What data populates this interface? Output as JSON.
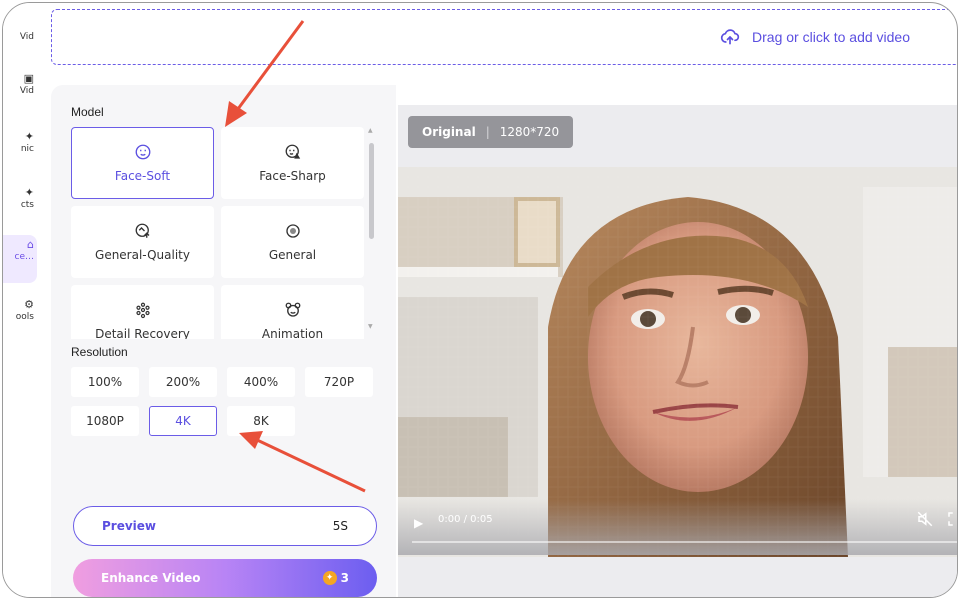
{
  "sidebar": {
    "items": [
      {
        "label": "Vid",
        "icon": "video-icon"
      },
      {
        "label": "Vid",
        "icon": "photo-video-icon"
      },
      {
        "label": "nic",
        "icon": "sparkle-icon"
      },
      {
        "label": "cts",
        "icon": "effects-icon"
      },
      {
        "label": "ce…",
        "icon": "enhance-icon",
        "active": true
      },
      {
        "label": "ools",
        "icon": "tools-icon"
      }
    ]
  },
  "upload": {
    "label": "Drag or click to add video"
  },
  "model_section": {
    "title": "Model",
    "models": [
      {
        "label": "Face-Soft",
        "icon": "face-soft-icon",
        "selected": true
      },
      {
        "label": "Face-Sharp",
        "icon": "face-sharp-icon"
      },
      {
        "label": "General-Quality",
        "icon": "general-quality-icon"
      },
      {
        "label": "General",
        "icon": "general-icon"
      },
      {
        "label": "Detail Recovery",
        "icon": "detail-recovery-icon"
      },
      {
        "label": "Animation",
        "icon": "animation-icon"
      }
    ]
  },
  "resolution_section": {
    "title": "Resolution",
    "options": [
      "100%",
      "200%",
      "400%",
      "720P",
      "1080P",
      "4K",
      "8K"
    ],
    "selected": "4K"
  },
  "preview_button": {
    "label": "Preview",
    "duration": "5S"
  },
  "enhance_button": {
    "label": "Enhance Video",
    "credits": "3"
  },
  "video": {
    "tag_label": "Original",
    "resolution": "1280*720",
    "time": "0:00 / 0:05",
    "progress": 0
  },
  "colors": {
    "accent": "#6b5ce7",
    "accent_text": "#5b4fe0",
    "arrow": "#e8503a"
  }
}
